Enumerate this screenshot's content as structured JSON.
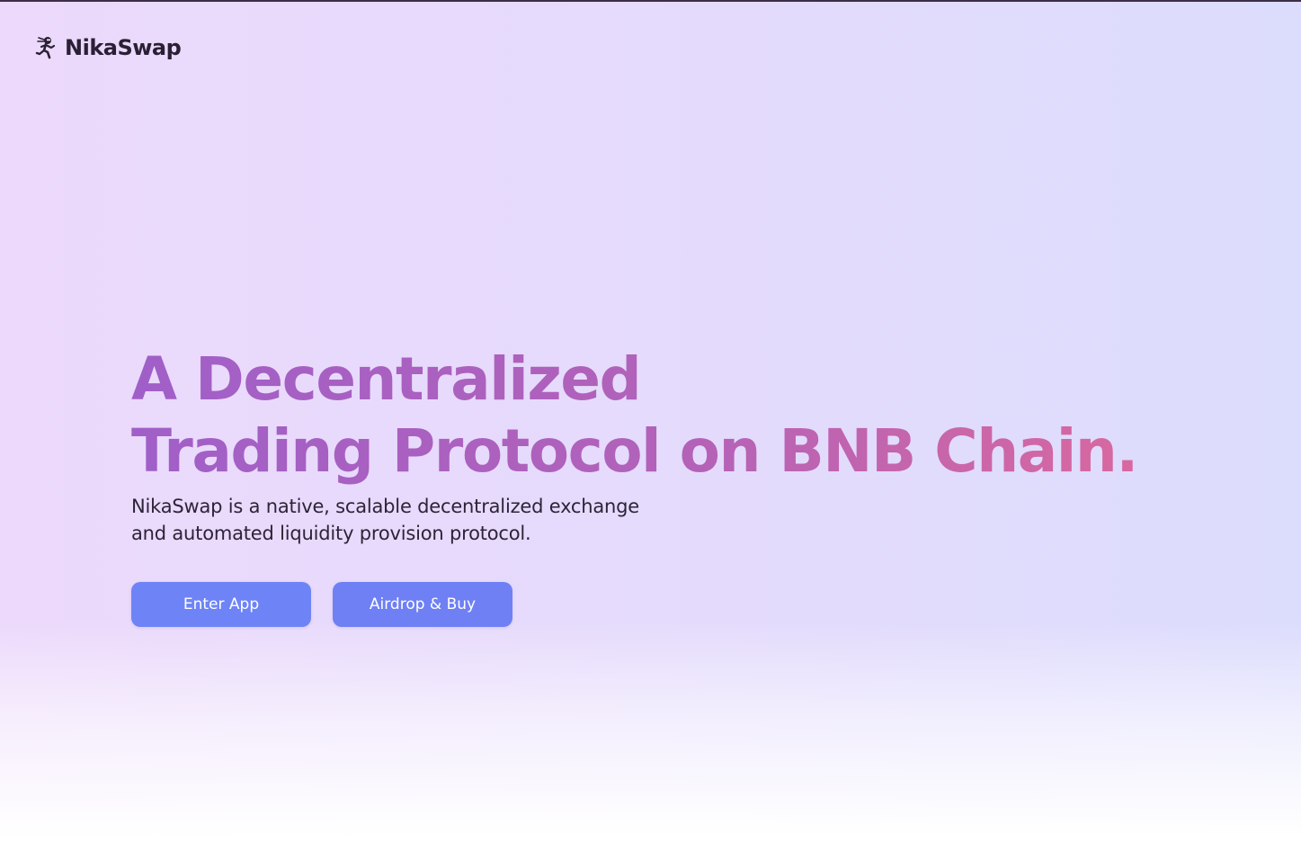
{
  "header": {
    "logo_icon": "ninja-runner-icon",
    "brand": "NikaSwap"
  },
  "hero": {
    "headline_line1": "A Decentralized",
    "headline_line2": "Trading Protocol on BNB Chain.",
    "subtitle_line1": "NikaSwap is a native, scalable decentralized exchange",
    "subtitle_line2": "and automated liquidity provision protocol."
  },
  "actions": {
    "enter_app": "Enter App",
    "airdrop_buy": "Airdrop & Buy"
  },
  "colors": {
    "button": "#6e84f6",
    "headline_start": "#a05fc8",
    "headline_end": "#d868a0",
    "text_dark": "#2a2036"
  }
}
